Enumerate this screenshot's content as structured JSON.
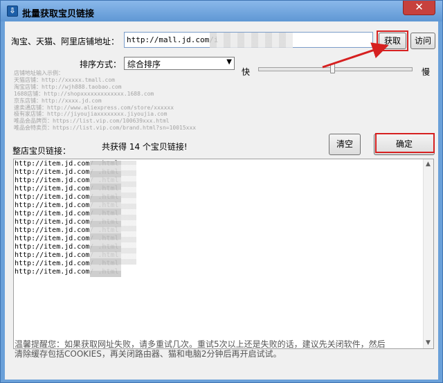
{
  "window": {
    "title": "批量获取宝贝链接",
    "close_glyph": "✕"
  },
  "form": {
    "shop_url_label": "淘宝、天猫、阿里店铺地址：",
    "shop_url_value": "http://mall.jd.com/i",
    "fetch_button": "获取",
    "visit_button": "访问",
    "sort_label": "排序方式：",
    "sort_selected": "综合排序",
    "speed_fast": "快",
    "speed_slow": "慢",
    "speed_level": 0.48
  },
  "examples": [
    "店铺地址输入示例：",
    "天猫店铺：http://xxxxx.tmall.com",
    "淘宝店铺：http://wjh888.taobao.com",
    "1688店铺：http://shopxxxxxxxxxxxxx.1688.com",
    "京东店铺：http://xxxx.jd.com",
    "速卖通店铺：http://www.aliexpress.com/store/xxxxxx",
    "极有家店铺：http://jiyoujiaxxxxxxxx.jiyoujia.com",
    "唯品会品牌页：https://list.vip.com/100639xxx.html",
    "唯品会特卖页：https://list.vip.com/brand.html?sn=10015xxx"
  ],
  "results": {
    "label": "整店宝贝链接：",
    "count_text": "共获得 14 个宝贝链接!",
    "clear_button": "清空",
    "confirm_button": "确定",
    "links": [
      "http://item.jd.com/          .html",
      "http://item.jd.com/          .html",
      "http://item.jd.com/          .html",
      "http://item.jd.com/          .html",
      "http://item.jd.com/          .html",
      "http://item.jd.com/          .html",
      "http://item.jd.com/          .html",
      "http://item.jd.com/          .html",
      "http://item.jd.com/          .html",
      "http://item.jd.com/          .html",
      "http://item.jd.com/          .html",
      "http://item.jd.com/          .html",
      "http://item.jd.com/          .html",
      "http://item.jd.com/          .html"
    ]
  },
  "tip": {
    "line1": "温馨提醒您：如果获取网址失败，请多重试几次。重试5次以上还是失败的话，建议先关闭软件，然后",
    "line2": "清除缓存包括COOKIES，再关闭路由器、猫和电脑2分钟后再开启试试。"
  },
  "colors": {
    "annotation_red": "#d62020",
    "titlebar": "#6aa0d9",
    "close_red": "#c7413d"
  }
}
